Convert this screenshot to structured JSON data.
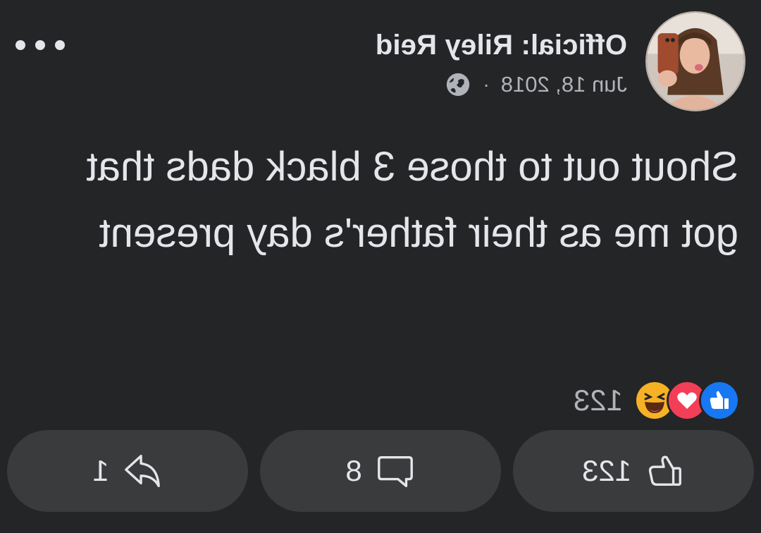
{
  "post": {
    "author": "Official: Riley Reid",
    "date": "Jun 18, 2018",
    "separator": "·",
    "privacy_icon": "globe-icon",
    "text": "Shout out to those 3 black dads that got me as their father's day present"
  },
  "menu": {
    "icon": "more-horizontal-icon"
  },
  "reactions": {
    "types": [
      "like",
      "love",
      "haha"
    ],
    "count": "123",
    "colors": {
      "like": "#1877f2",
      "love": "#f33e58",
      "haha": "#f7b125"
    }
  },
  "actions": {
    "like": {
      "icon": "thumbs-up-icon",
      "count": "123"
    },
    "comment": {
      "icon": "comment-bubble-icon",
      "count": "8"
    },
    "share": {
      "icon": "share-arrow-icon",
      "count": "1"
    }
  },
  "theme": {
    "background": "#242526",
    "button_bg": "#3a3b3c",
    "primary_text": "#e4e6eb",
    "secondary_text": "#b0b3b8"
  }
}
